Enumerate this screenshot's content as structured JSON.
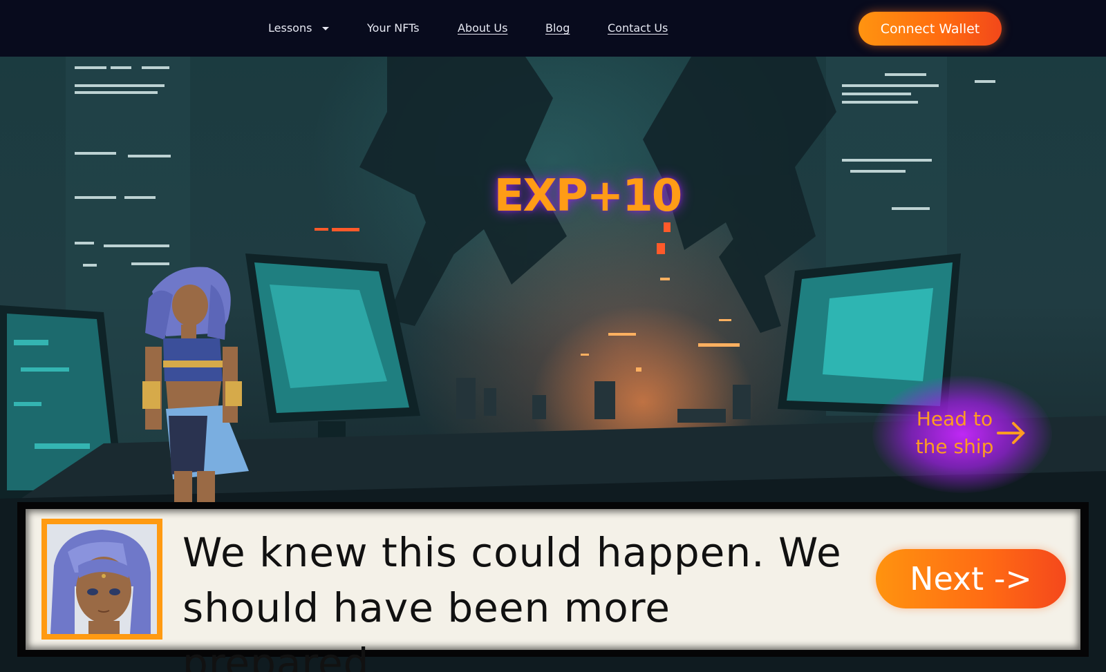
{
  "nav": {
    "items": [
      {
        "label": "Lessons",
        "dropdown": true
      },
      {
        "label": "Your NFTs"
      },
      {
        "label": "About Us"
      },
      {
        "label": "Blog"
      },
      {
        "label": "Contact Us"
      }
    ],
    "connect_label": "Connect Wallet"
  },
  "scene": {
    "exp_label": "EXP+10",
    "ship_label_line1": "Head to",
    "ship_label_line2": "the ship",
    "ship_arrow_icon": "arrow-right-icon"
  },
  "dialog": {
    "text": "We knew this could happen. We should have been more prepared.",
    "next_label": "Next ->",
    "portrait_icon": "character-portrait"
  },
  "colors": {
    "accent_orange": "#ff9a12",
    "nav_bg": "#080b1d",
    "ship_glow": "#b41ef0",
    "dialog_bg": "#f4f1e8"
  }
}
